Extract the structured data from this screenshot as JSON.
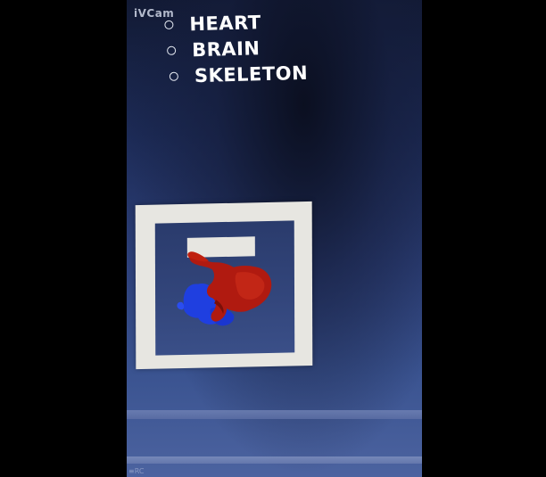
{
  "watermark": "iVCam",
  "menu": {
    "items": [
      {
        "label": "HEART"
      },
      {
        "label": "BRAIN"
      },
      {
        "label": "SKELETON"
      }
    ]
  },
  "corner_text": "≡RC",
  "colors": {
    "background_top": "#121a34",
    "background_bottom": "#4c63a0",
    "marker_frame": "#e7e6e1",
    "heart_red": "#b01a10",
    "heart_blue": "#1f3fe0",
    "menu_text": "#ffffff"
  },
  "model": "heart-3d-model"
}
